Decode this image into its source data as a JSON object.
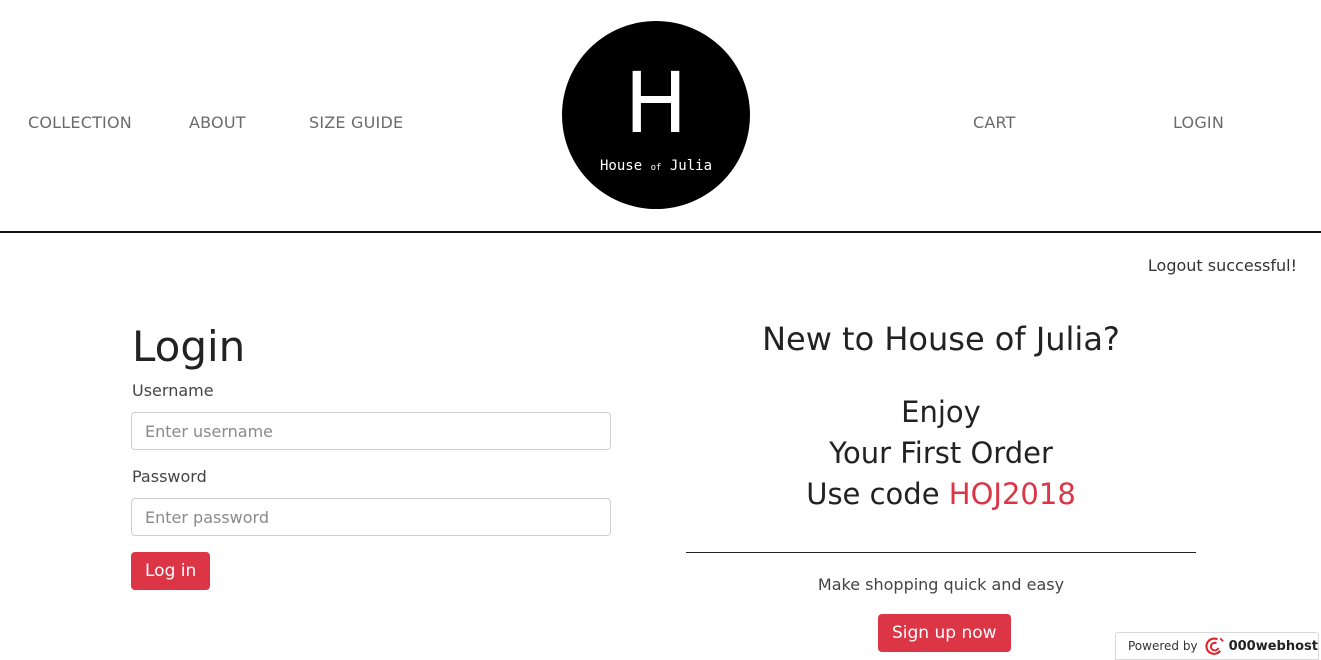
{
  "nav": {
    "collection": "COLLECTION",
    "about": "ABOUT",
    "size_guide": "SIZE GUIDE",
    "cart": "CART",
    "login": "LOGIN"
  },
  "logo": {
    "letter": "H",
    "name_part1": "House",
    "name_small": "of",
    "name_part2": "Julia"
  },
  "flash_message": "Logout successful!",
  "login_form": {
    "title": "Login",
    "username_label": "Username",
    "username_placeholder": "Enter username",
    "password_label": "Password",
    "password_placeholder": "Enter password",
    "submit_label": "Log in"
  },
  "promo": {
    "heading": "New to House of Julia?",
    "line1": "Enjoy",
    "line2": "Your First Order",
    "line3_prefix": "Use code",
    "code": "HOJ2018",
    "tagline": "Make shopping quick and easy",
    "signup_label": "Sign up now"
  },
  "footer_badge": {
    "prefix": "Powered by",
    "brand": "000webhost",
    "icon": "webhost-logo-icon"
  },
  "colors": {
    "accent": "#dc3545",
    "nav_text": "#6b6b6b",
    "logo_bg": "#000000"
  }
}
